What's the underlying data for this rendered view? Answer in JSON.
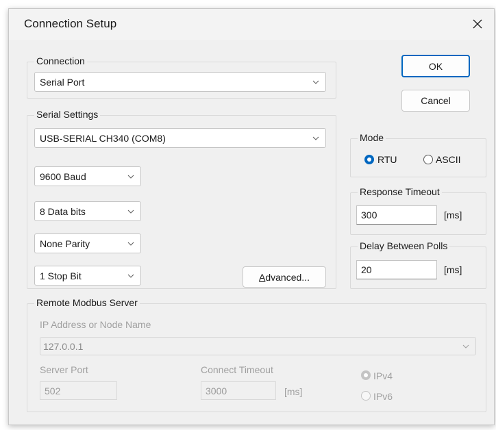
{
  "window": {
    "title": "Connection Setup"
  },
  "buttons": {
    "ok": "OK",
    "cancel": "Cancel",
    "advanced_prefix": "A",
    "advanced_rest": "dvanced..."
  },
  "connection": {
    "legend": "Connection",
    "type": "Serial Port"
  },
  "serial": {
    "legend": "Serial Settings",
    "port": "USB-SERIAL CH340 (COM8)",
    "baud": "9600 Baud",
    "data_bits": "8 Data bits",
    "parity": "None Parity",
    "stop_bits": "1 Stop Bit"
  },
  "mode": {
    "legend": "Mode",
    "rtu": "RTU",
    "ascii": "ASCII",
    "selected": "RTU"
  },
  "response_timeout": {
    "legend": "Response Timeout",
    "value": "300",
    "unit": "[ms]"
  },
  "delay_polls": {
    "legend": "Delay Between Polls",
    "value": "20",
    "unit": "[ms]"
  },
  "remote": {
    "legend": "Remote Modbus Server",
    "ip_label": "IP Address or Node Name",
    "ip_value": "127.0.0.1",
    "port_label": "Server Port",
    "port_value": "502",
    "timeout_label": "Connect Timeout",
    "timeout_value": "3000",
    "timeout_unit": "[ms]",
    "ipv4": "IPv4",
    "ipv6": "IPv6",
    "selected_ip": "IPv4"
  },
  "colors": {
    "accent": "#0067c0",
    "dialog_bg": "#f0f0f0"
  }
}
